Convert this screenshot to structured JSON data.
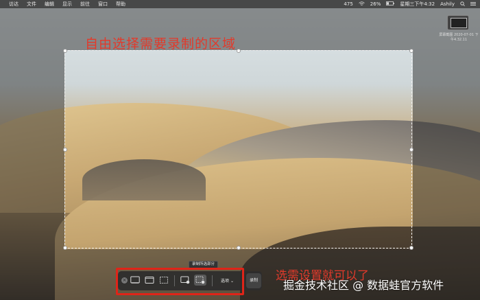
{
  "menubar": {
    "apple": "",
    "items": [
      "访达",
      "文件",
      "编辑",
      "显示",
      "前往",
      "窗口",
      "帮助"
    ],
    "battery_pct": "475",
    "battery": "26%",
    "datetime": "星期三下午4:32",
    "user": "Ashily"
  },
  "thumbnail": {
    "label": "屏幕截图 2020-07-01 下午4.32.11"
  },
  "annotations": {
    "top_note": "自由选择需要录制的区域",
    "bottom_note": "选需设置就可以了"
  },
  "toolbar": {
    "tooltip": "录制所选部分",
    "close_glyph": "×",
    "options_label": "选项",
    "options_chevron": "⌄",
    "record_label": "录制"
  },
  "watermark": "掘金技术社区 @ 数据蛙官方软件",
  "colors": {
    "annotation_red": "#e23a2b",
    "redbox": "#e02418"
  }
}
